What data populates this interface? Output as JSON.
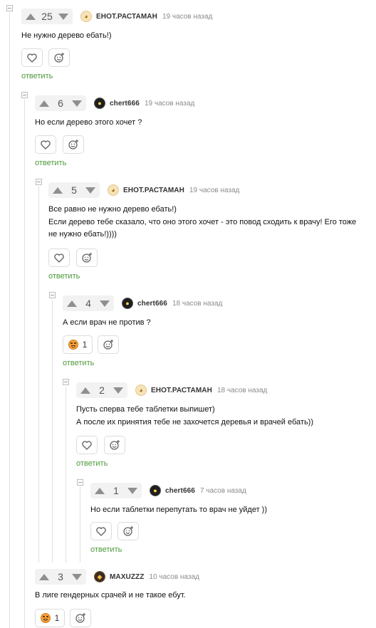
{
  "reply_label": "ответить",
  "colors": {
    "accent_green": "#4d9a3a",
    "vote_bg": "#f2f2f2"
  },
  "comments": [
    {
      "score": "25",
      "user": "ЕНОТ.РАСТАМАН",
      "time": "19 часов назад",
      "avatar": "raccoon-avatar",
      "lines": [
        "Не нужно дерево ебать!)"
      ],
      "reaction_count": ""
    },
    {
      "score": "6",
      "user": "chert666",
      "time": "19 часов назад",
      "avatar": "devil-avatar",
      "lines": [
        "Но если дерево этого хочет ?"
      ],
      "reaction_count": ""
    },
    {
      "score": "5",
      "user": "ЕНОТ.РАСТАМАН",
      "time": "19 часов назад",
      "avatar": "raccoon-avatar",
      "lines": [
        "Все равно не нужно дерево ебать!)",
        "Если дерево тебе сказало, что оно этого хочет - это повод сходить к врачу! Его тоже",
        "не нужно ебать!))))"
      ],
      "reaction_count": ""
    },
    {
      "score": "4",
      "user": "chert666",
      "time": "18 часов назад",
      "avatar": "devil-avatar",
      "lines": [
        "А если врач не против ?"
      ],
      "reaction_count": "1"
    },
    {
      "score": "2",
      "user": "ЕНОТ.РАСТАМАН",
      "time": "18 часов назад",
      "avatar": "raccoon-avatar",
      "lines": [
        "Пусть сперва тебе таблетки выпишет)",
        "А после их принятия тебе не захочется деревья и врачей ебать))"
      ],
      "reaction_count": ""
    },
    {
      "score": "1",
      "user": "chert666",
      "time": "7 часов назад",
      "avatar": "devil-avatar",
      "lines": [
        "Но если таблетки перепутать то врач не уйдет ))"
      ],
      "reaction_count": ""
    },
    {
      "score": "3",
      "user": "MAXUZZZ",
      "time": "10 часов назад",
      "avatar": "user-avatar",
      "lines": [
        "В лиге гендерных срачей и не такое ебут."
      ],
      "reaction_count": "1"
    }
  ]
}
